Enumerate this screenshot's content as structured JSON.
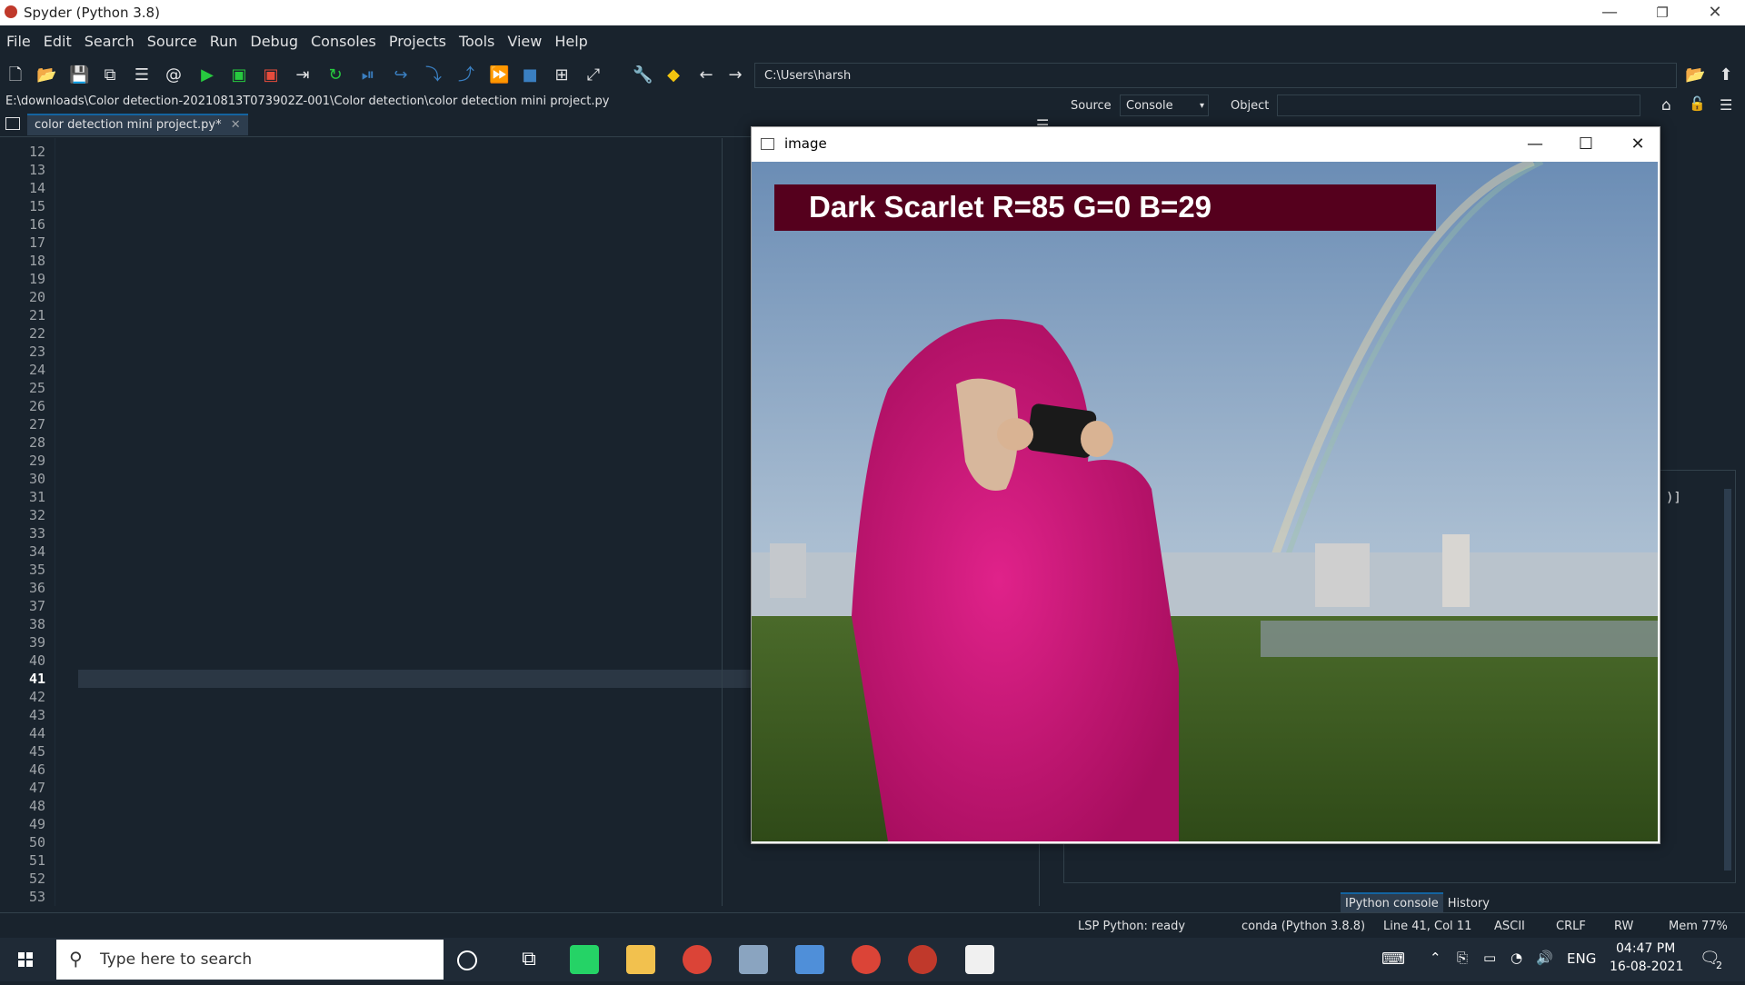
{
  "window": {
    "title": "Spyder (Python 3.8)"
  },
  "menu": [
    "File",
    "Edit",
    "Search",
    "Source",
    "Run",
    "Debug",
    "Consoles",
    "Projects",
    "Tools",
    "View",
    "Help"
  ],
  "toolbar": {
    "working_dir": "C:\\Users\\harsh"
  },
  "editor": {
    "file_path": "E:\\downloads\\Color detection-20210813T073902Z-001\\Color detection\\color detection mini project.py",
    "tab_label": "color detection mini project.py*",
    "current_line": "41",
    "line_numbers": [
      "12",
      "13",
      "14",
      "15",
      "16",
      "17",
      "18",
      "19",
      "20",
      "21",
      "22",
      "23",
      "24",
      "25",
      "26",
      "27",
      "28",
      "29",
      "30",
      "31",
      "32",
      "33",
      "34",
      "35",
      "36",
      "37",
      "38",
      "39",
      "40",
      "41",
      "42",
      "43",
      "44",
      "45",
      "46",
      "47",
      "48",
      "49",
      "50",
      "51",
      "52",
      "53"
    ]
  },
  "help_pane": {
    "source_label": "Source",
    "source_value": "Console",
    "object_label": "Object"
  },
  "console_tabs": [
    "IPython console",
    "History"
  ],
  "console_fragment": ")]",
  "image_window": {
    "title": "image",
    "banner_text": "Dark Scarlet R=85 G=0 B=29",
    "banner_color": "#55001d"
  },
  "statusbar": {
    "lsp": "LSP Python: ready",
    "env": "conda (Python 3.8.8)",
    "position": "Line 41, Col 11",
    "encoding": "ASCII",
    "eol": "CRLF",
    "perm": "RW",
    "mem": "Mem 77%"
  },
  "taskbar": {
    "search_placeholder": "Type here to search",
    "lang": "ENG",
    "time": "04:47 PM",
    "date": "16-08-2021",
    "notif_count": "2"
  }
}
